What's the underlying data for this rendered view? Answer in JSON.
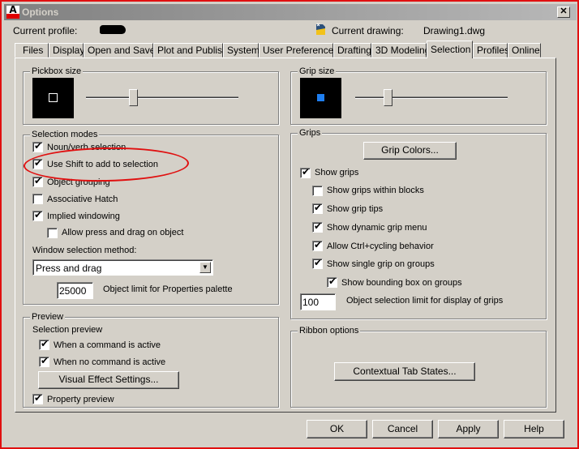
{
  "window": {
    "title": "Options",
    "close_label": "✕"
  },
  "header": {
    "current_profile_label": "Current profile:",
    "current_drawing_label": "Current drawing:",
    "current_drawing_value": "Drawing1.dwg"
  },
  "tabs": [
    {
      "label": "Files",
      "active": false
    },
    {
      "label": "Display",
      "active": false
    },
    {
      "label": "Open and Save",
      "active": false
    },
    {
      "label": "Plot and Publish",
      "active": false
    },
    {
      "label": "System",
      "active": false
    },
    {
      "label": "User Preferences",
      "active": false
    },
    {
      "label": "Drafting",
      "active": false
    },
    {
      "label": "3D Modeling",
      "active": false
    },
    {
      "label": "Selection",
      "active": true
    },
    {
      "label": "Profiles",
      "active": false
    },
    {
      "label": "Online",
      "active": false
    }
  ],
  "pickbox": {
    "title": "Pickbox size",
    "slider_fraction": 0.3
  },
  "grip_size": {
    "title": "Grip size",
    "slider_fraction": 0.2,
    "grip_color": "#1e7ef0"
  },
  "selection_modes": {
    "title": "Selection modes",
    "options": [
      {
        "label": "Noun/verb selection",
        "checked": true
      },
      {
        "label": "Use Shift to add to selection",
        "checked": true
      },
      {
        "label": "Object grouping",
        "checked": true
      },
      {
        "label": "Associative Hatch",
        "checked": false
      },
      {
        "label": "Implied windowing",
        "checked": true
      },
      {
        "label": "Allow press and drag on object",
        "checked": false
      }
    ],
    "window_method_label": "Window selection method:",
    "window_method_value": "Press and drag",
    "object_limit_value": "25000",
    "object_limit_label": "Object limit for Properties palette"
  },
  "preview": {
    "title": "Preview",
    "selection_preview_label": "Selection preview",
    "options": [
      {
        "label": "When a command is active",
        "checked": true
      },
      {
        "label": "When no command is active",
        "checked": true
      }
    ],
    "visual_effect_button": "Visual Effect Settings...",
    "property_preview": {
      "label": "Property preview",
      "checked": true
    }
  },
  "grips": {
    "title": "Grips",
    "grip_colors_button": "Grip Colors...",
    "options": [
      {
        "label": "Show grips",
        "checked": true
      },
      {
        "label": "Show grips within blocks",
        "checked": false
      },
      {
        "label": "Show grip tips",
        "checked": true
      },
      {
        "label": "Show dynamic grip menu",
        "checked": true
      },
      {
        "label": "Allow Ctrl+cycling behavior",
        "checked": true
      },
      {
        "label": "Show single grip on groups",
        "checked": true
      },
      {
        "label": "Show bounding box on groups",
        "checked": true
      }
    ],
    "limit_value": "100",
    "limit_label": "Object selection limit for display of grips"
  },
  "ribbon": {
    "title": "Ribbon options",
    "contextual_button": "Contextual Tab States..."
  },
  "footer": {
    "ok": "OK",
    "cancel": "Cancel",
    "apply": "Apply",
    "help": "Help"
  },
  "checkmark": "✔",
  "combo_arrow": "▼"
}
